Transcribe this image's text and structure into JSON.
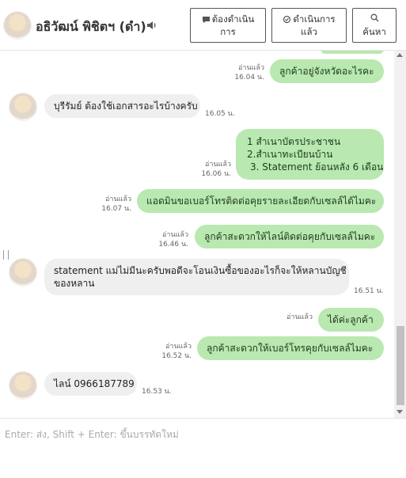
{
  "header": {
    "contact_name": "อธิวัฒน์ พิชิตฯ (ดำ)",
    "btn_pending_line1": "ต้องดำเนิน",
    "btn_pending_line2": "การ",
    "btn_done_line1": "ดำเนินการ",
    "btn_done_line2": "แล้ว",
    "btn_search": "ค้นหา"
  },
  "messages": [
    {
      "side": "out",
      "text": "ลูกค้าอยู่จังหวัดอะไรคะ",
      "read": "อ่านแล้ว",
      "time": "16.04 น."
    },
    {
      "side": "in",
      "text": "บุรีรัมย์ ต้องใช้เอกสารอะไรบ้างครับ",
      "time": "16.05 น."
    },
    {
      "side": "out",
      "lines": [
        "1 สำเนาบัตรประชาชน",
        "2.สำเนาทะเบียนบ้าน",
        "3. Statement ย้อนหลัง 6 เดือน"
      ],
      "read": "อ่านแล้ว",
      "time": "16.06 น."
    },
    {
      "side": "out",
      "text": "แอดมินขอเบอร์โทรติดต่อคุยรายละเอียดกับเซลล์ได้ไมคะ",
      "read": "อ่านแล้ว",
      "time": "16.07 น."
    },
    {
      "side": "out",
      "text": "ลูกค้าสะดวกให้ไลน์ติดต่อคุยกับเซลล์ไมคะ",
      "read": "อ่านแล้ว",
      "time": "16.46 น."
    },
    {
      "side": "in",
      "lines": [
        "statement แม่ไม่มีนะครับพอดีจะโอนเงินซื้อของอะไรก็จะให้หลานบัญชี",
        "ของหลาน"
      ],
      "time": "16.51 น."
    },
    {
      "side": "out",
      "text": "ได้ค่ะลูกค้า",
      "read": "อ่านแล้ว",
      "time": ""
    },
    {
      "side": "out",
      "text": "ลูกค้าสะดวกให้เบอร์โทรคุยกับเซลล์ไมคะ",
      "read": "อ่านแล้ว",
      "time": "16.52 น."
    },
    {
      "side": "in",
      "text": "ไลน์ 0966187789",
      "time": "16.53 น."
    }
  ],
  "composer": {
    "placeholder": "Enter: ส่ง, Shift + Enter: ขึ้นบรรทัดใหม่"
  }
}
